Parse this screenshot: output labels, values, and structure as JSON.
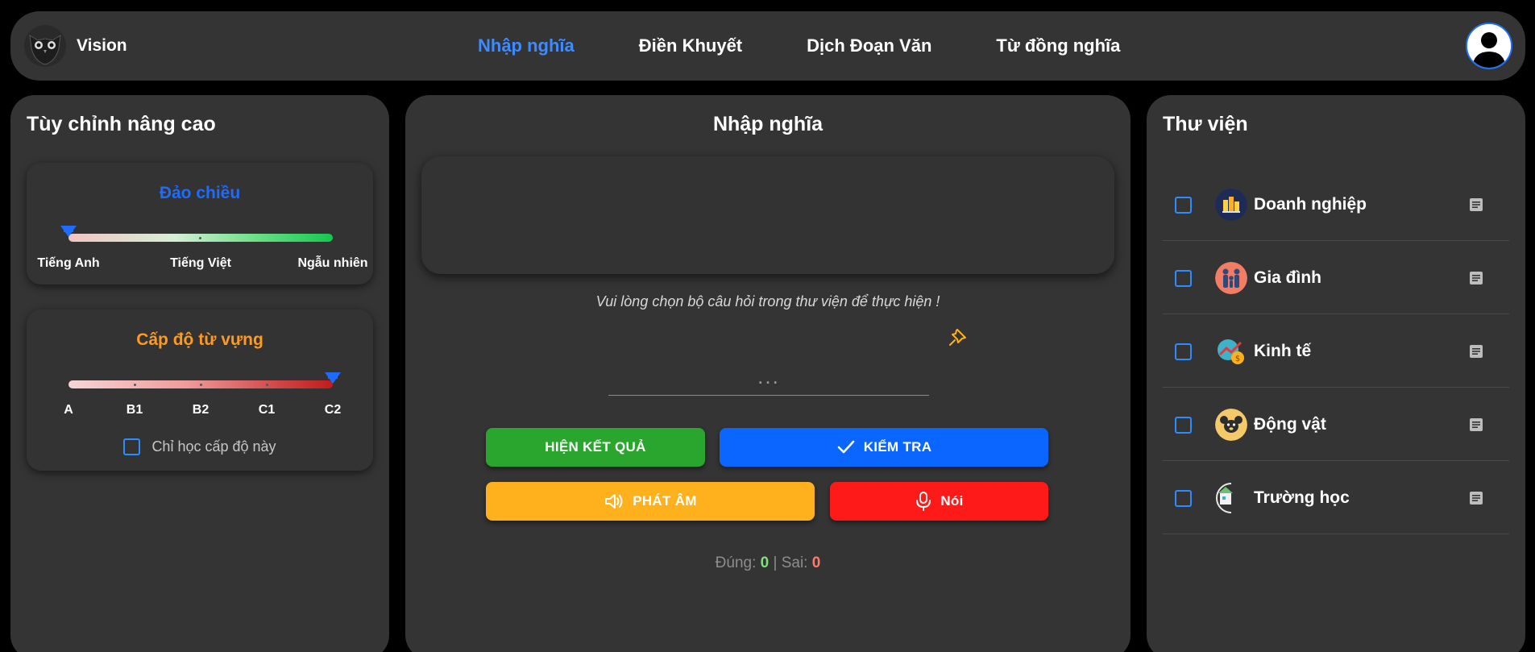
{
  "brand": {
    "name": "Vision"
  },
  "nav": {
    "items": [
      "Nhập nghĩa",
      "Điền Khuyết",
      "Dịch Đoạn Văn",
      "Từ đồng nghĩa"
    ],
    "active": "Nhập nghĩa"
  },
  "left_panel": {
    "title": "Tùy chỉnh nâng cao",
    "direction": {
      "title": "Đảo chiều",
      "title_color": "#1e6cff",
      "labels": [
        "Tiếng Anh",
        "Tiếng Việt",
        "Ngẫu nhiên"
      ],
      "selected": "Tiếng Anh",
      "value_fraction": 0
    },
    "level": {
      "title": "Cấp độ từ vựng",
      "title_color": "#ff9a1f",
      "labels": [
        "A",
        "B1",
        "B2",
        "C1",
        "C2"
      ],
      "selected": "C2",
      "value_fraction": 1,
      "only_this_level_label": "Chỉ học cấp độ này",
      "only_this_level_checked": false
    }
  },
  "center": {
    "title": "Nhập nghĩa",
    "hint": "Vui lòng chọn bộ câu hỏi trong thư viện để thực hiện !",
    "answer_placeholder": "...",
    "buttons": {
      "show_result": "HIỆN KẾT QUẢ",
      "check": "KIỂM TRA",
      "pronounce": "PHÁT ÂM",
      "speak": "Nói"
    },
    "score": {
      "correct_label": "Đúng:",
      "correct": "0",
      "separator": "|",
      "wrong_label": "Sai:",
      "wrong": "0"
    }
  },
  "library": {
    "title": "Thư viện",
    "items": [
      {
        "label": "Doanh nghiệp",
        "icon": "business-icon",
        "checked": false
      },
      {
        "label": "Gia đình",
        "icon": "family-icon",
        "checked": false
      },
      {
        "label": "Kinh tế",
        "icon": "economy-icon",
        "checked": false
      },
      {
        "label": "Động vật",
        "icon": "animal-icon",
        "checked": false
      },
      {
        "label": "Trường học",
        "icon": "school-icon",
        "checked": false
      }
    ]
  },
  "colors": {
    "accent_blue": "#3d8bff",
    "green_button": "#2aa52e",
    "blue_button": "#0a66ff",
    "yellow_button": "#ffb11d",
    "red_button": "#ff1a1a"
  }
}
